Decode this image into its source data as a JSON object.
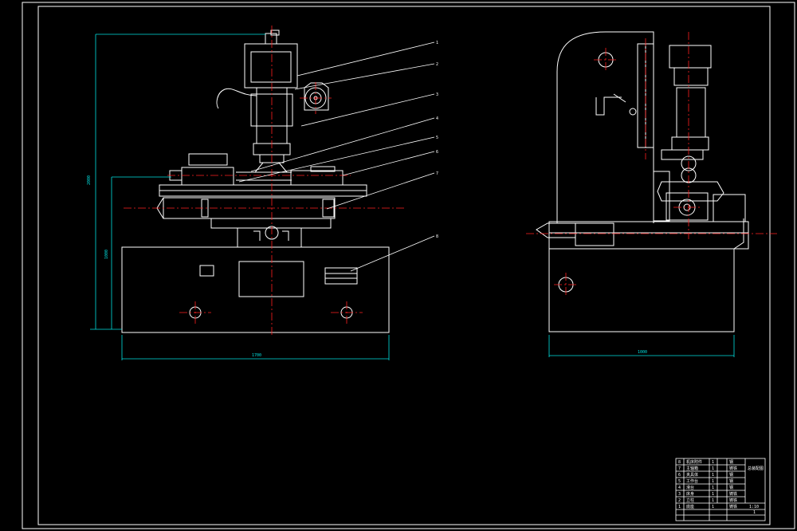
{
  "drawing": {
    "background": "#000000",
    "line_color": "#ffffff",
    "center_line_color": "#ff2020",
    "dimension_color": "#00e0e0"
  },
  "front_view": {
    "dim_overall_height": "2000",
    "dim_table_height": "1000",
    "dim_base_width": "1700",
    "leaders": [
      "1",
      "2",
      "3",
      "4",
      "5",
      "6",
      "7",
      "8"
    ]
  },
  "side_view": {
    "dim_base_depth": "1000"
  },
  "title_block": {
    "rows": [
      [
        "8",
        "机床附件",
        "1",
        "",
        "钢"
      ],
      [
        "7",
        "主轴箱",
        "1",
        "",
        "铸铁"
      ],
      [
        "6",
        "夹具体",
        "1",
        "",
        "钢"
      ],
      [
        "5",
        "工作台",
        "1",
        "",
        "钢"
      ],
      [
        "4",
        "滑台",
        "1",
        "",
        "钢"
      ],
      [
        "3",
        "床身",
        "1",
        "",
        "铸铁"
      ],
      [
        "2",
        "立柱",
        "1",
        "",
        "铸铁"
      ],
      [
        "1",
        "底座",
        "1",
        "",
        "铸铁"
      ]
    ],
    "name": "总装配图",
    "scale": "1:10",
    "sheet": "1"
  }
}
